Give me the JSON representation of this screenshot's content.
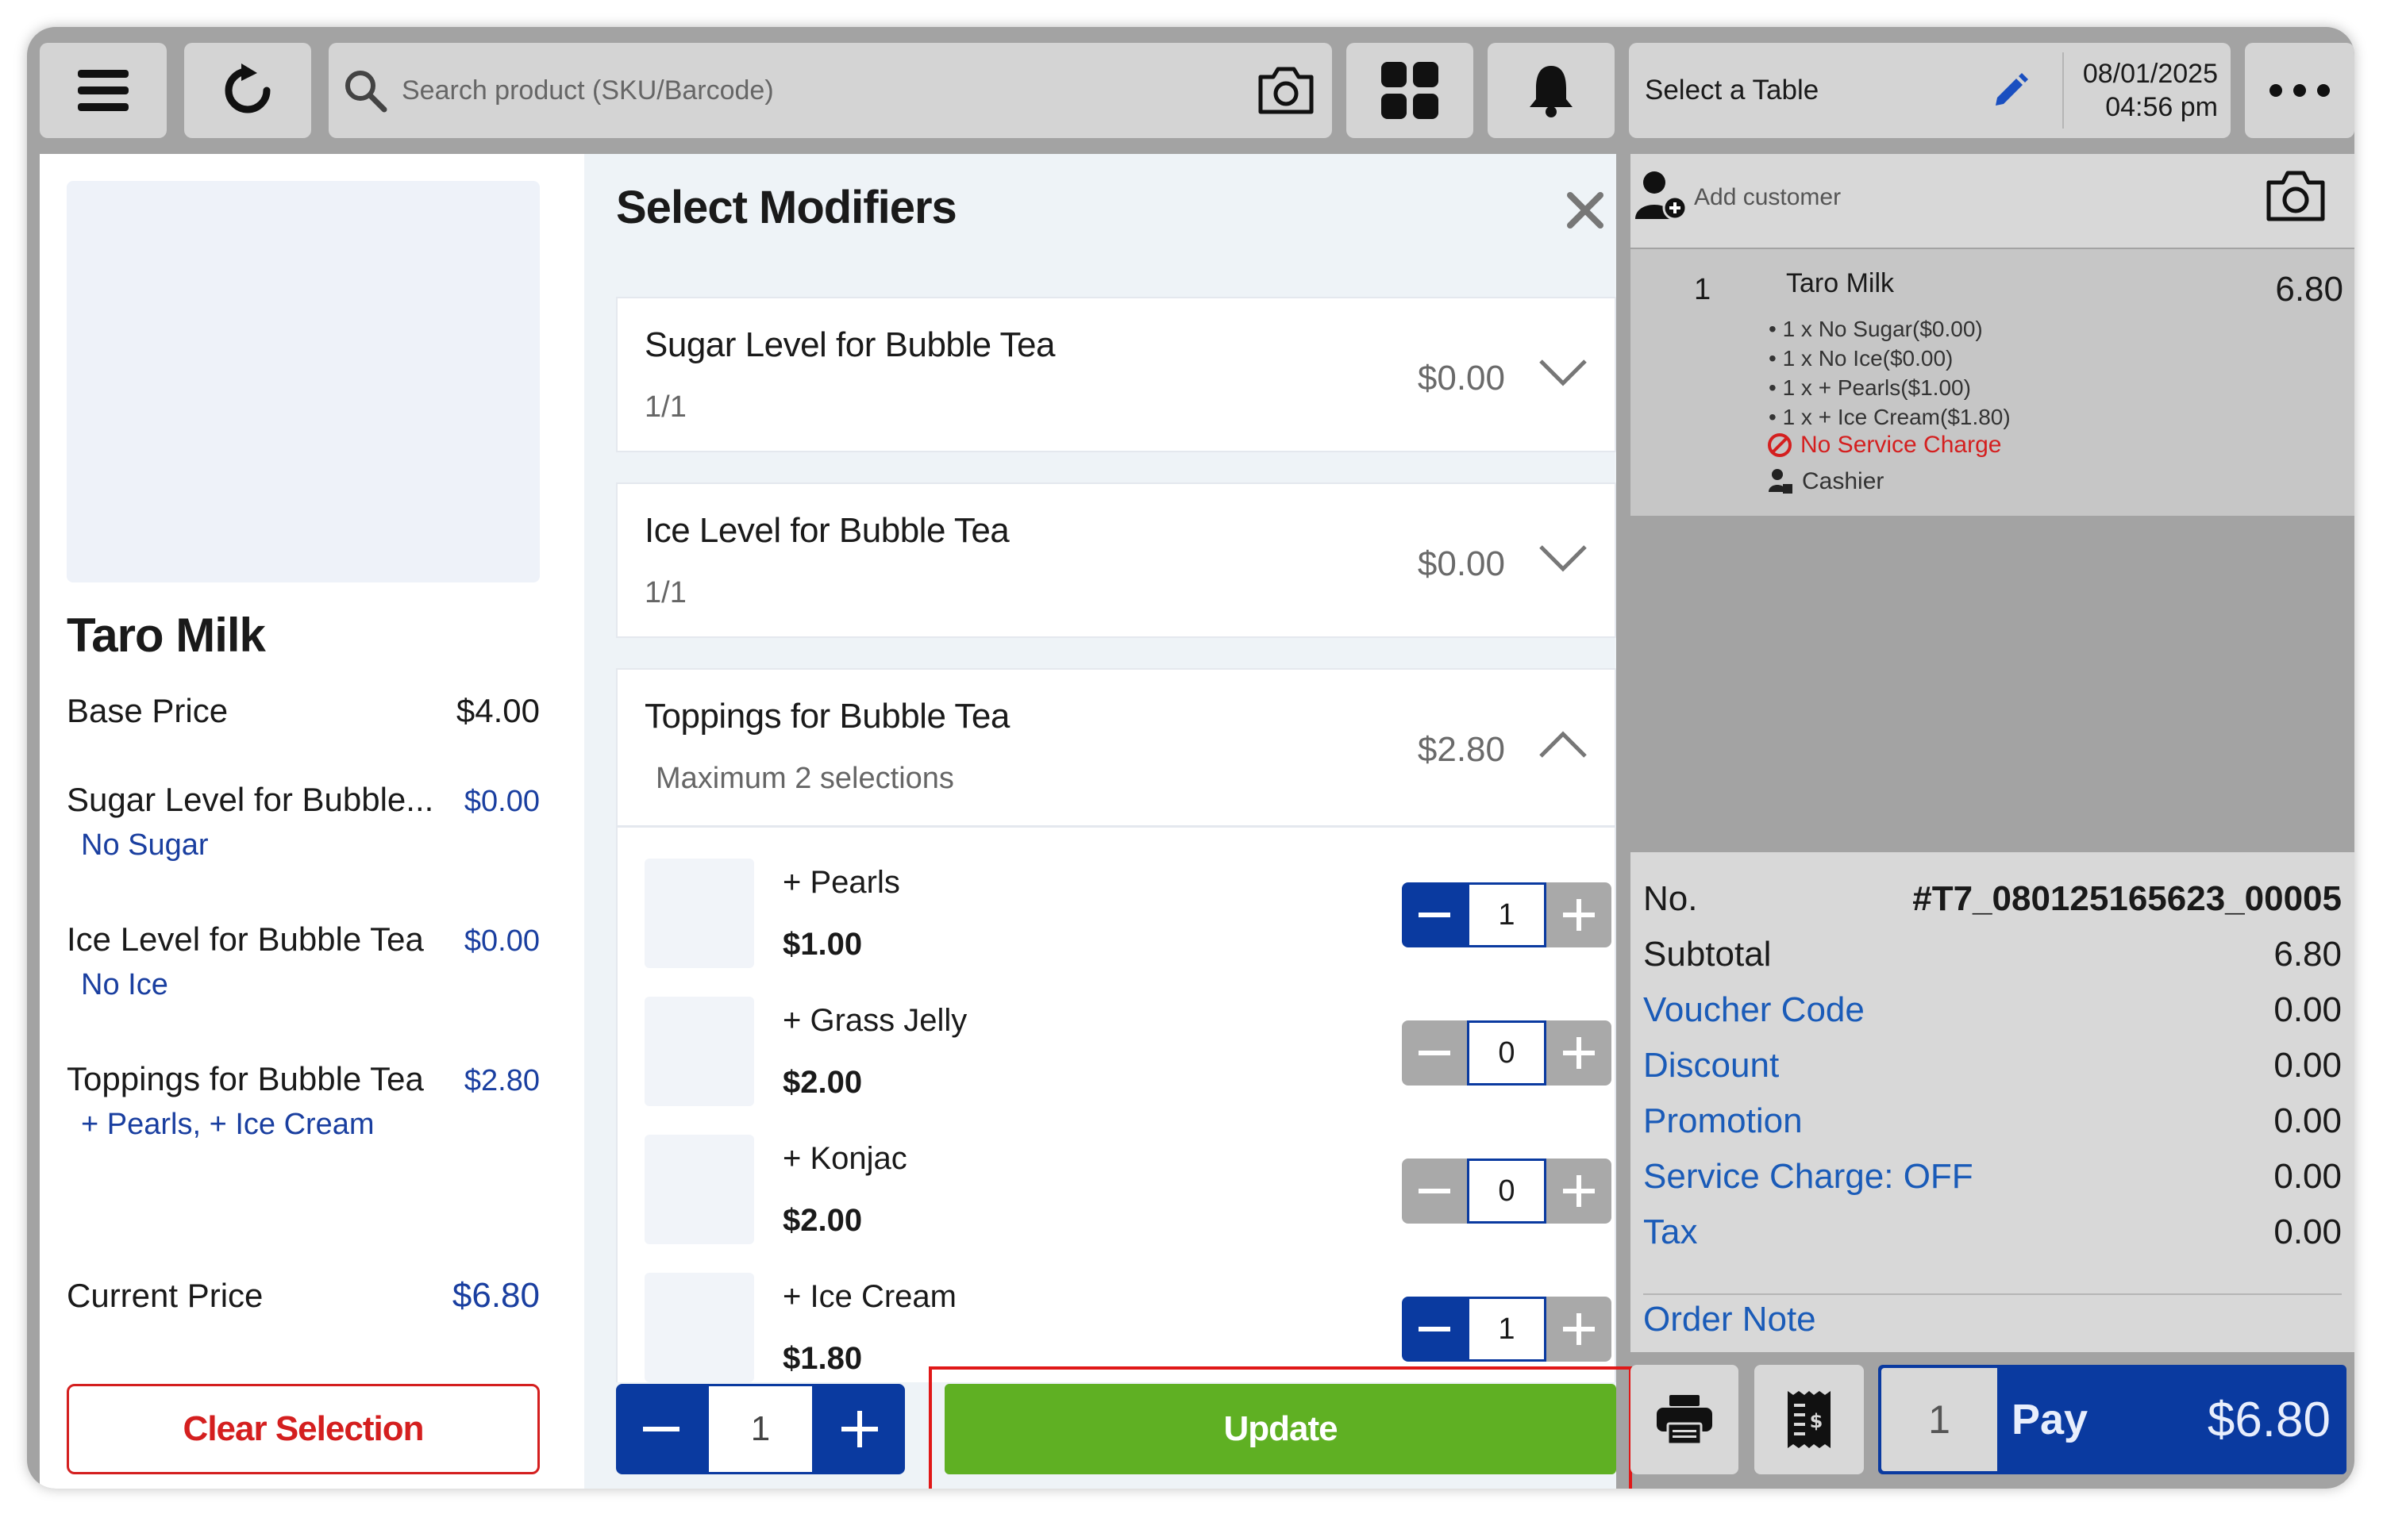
{
  "topbar": {
    "search_placeholder": "Search product (SKU/Barcode)",
    "table_label": "Select a Table",
    "date": "08/01/2025",
    "time": "04:56 pm"
  },
  "product": {
    "name": "Taro Milk",
    "base_price_label": "Base Price",
    "base_price": "$4.00",
    "groups": [
      {
        "name": "Sugar Level for Bubble...",
        "price": "$0.00",
        "selection": "No Sugar"
      },
      {
        "name": "Ice Level for Bubble Tea",
        "price": "$0.00",
        "selection": "No Ice"
      },
      {
        "name": "Toppings for Bubble Tea",
        "price": "$2.80",
        "selection": "+ Pearls, + Ice Cream"
      }
    ],
    "current_price_label": "Current Price",
    "current_price": "$6.80",
    "clear_label": "Clear Selection"
  },
  "modifiers": {
    "title": "Select Modifiers",
    "cards": [
      {
        "name": "Sugar Level for Bubble Tea",
        "sub": "1/1",
        "price": "$0.00"
      },
      {
        "name": "Ice Level for Bubble Tea",
        "sub": "1/1",
        "price": "$0.00"
      },
      {
        "name": "Toppings for Bubble Tea",
        "sub": "Maximum 2 selections",
        "price": "$2.80"
      }
    ],
    "toppings": [
      {
        "name": "+ Pearls",
        "price": "$1.00",
        "qty": "1"
      },
      {
        "name": "+ Grass Jelly",
        "price": "$2.00",
        "qty": "0"
      },
      {
        "name": "+ Konjac",
        "price": "$2.00",
        "qty": "0"
      },
      {
        "name": "+ Ice Cream",
        "price": "$1.80",
        "qty": "1"
      }
    ],
    "quantity": "1",
    "update_label": "Update"
  },
  "order": {
    "add_customer": "Add customer",
    "item": {
      "qty": "1",
      "name": "Taro Milk",
      "amount": "6.80",
      "mods": [
        "• 1 x No Sugar($0.00)",
        "• 1 x No Ice($0.00)",
        "• 1 x + Pearls($1.00)",
        "• 1 x + Ice Cream($1.80)"
      ],
      "service_charge": "No Service Charge",
      "staff": "Cashier"
    },
    "summary": {
      "no_label": "No.",
      "no_value": "#T7_080125165623_00005",
      "rows": [
        {
          "label": "Subtotal",
          "value": "6.80"
        },
        {
          "label": "Voucher Code",
          "value": "0.00"
        },
        {
          "label": "Discount",
          "value": "0.00"
        },
        {
          "label": "Promotion",
          "value": "0.00"
        },
        {
          "label": "Service Charge: OFF",
          "value": "0.00"
        },
        {
          "label": "Tax",
          "value": "0.00"
        }
      ],
      "note_label": "Order Note"
    },
    "pay": {
      "qty": "1",
      "label": "Pay",
      "amount": "$6.80"
    }
  },
  "colors": {
    "primary": "#0a3aa0",
    "update_green": "#5fb023",
    "danger": "#d41f1f",
    "link_blue": "#1a5bb8"
  }
}
